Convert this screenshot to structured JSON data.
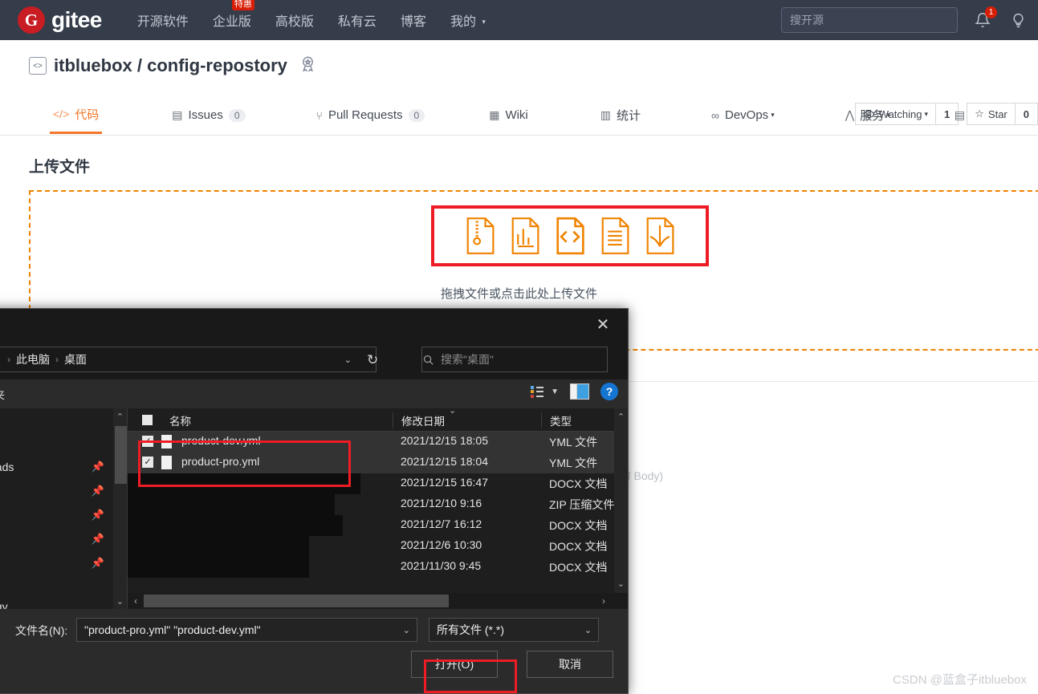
{
  "topnav": {
    "brand_letter": "G",
    "brand": "gitee",
    "items": [
      {
        "label": "开源软件",
        "badge": null,
        "caret": false
      },
      {
        "label": "企业版",
        "badge": "特惠",
        "caret": false
      },
      {
        "label": "高校版",
        "badge": null,
        "caret": false
      },
      {
        "label": "私有云",
        "badge": null,
        "caret": false
      },
      {
        "label": "博客",
        "badge": null,
        "caret": false
      },
      {
        "label": "我的",
        "badge": null,
        "caret": true
      }
    ],
    "search_placeholder": "搜开源",
    "notification_count": "1",
    "bell_icon": "bell-icon",
    "bulb_icon": "lightbulb-icon"
  },
  "repo": {
    "owner": "itbluebox",
    "separator": "/",
    "name": "config-repostory",
    "full_title": "itbluebox / config-repostory",
    "code_icon": "<>",
    "medal_icon": "medal-icon",
    "watch_label": "Watching",
    "watch_count": "1",
    "star_label": "Star",
    "star_count": "0"
  },
  "tabs": [
    {
      "label": "代码",
      "icon": "code-icon",
      "count": null,
      "active": true,
      "caret": false
    },
    {
      "label": "Issues",
      "icon": "issue-icon",
      "count": "0",
      "active": false,
      "caret": false
    },
    {
      "label": "Pull Requests",
      "icon": "pr-icon",
      "count": "0",
      "active": false,
      "caret": false
    },
    {
      "label": "Wiki",
      "icon": "wiki-icon",
      "count": null,
      "active": false,
      "caret": false
    },
    {
      "label": "统计",
      "icon": "chart-icon",
      "count": null,
      "active": false,
      "caret": false
    },
    {
      "label": "DevOps",
      "icon": "infinity-icon",
      "count": null,
      "active": false,
      "caret": true
    },
    {
      "label": "服务",
      "icon": "pulse-icon",
      "count": null,
      "active": false,
      "caret": true
    }
  ],
  "upload": {
    "title": "上传文件",
    "hint": "拖拽文件或点击此处上传文件",
    "filetypes": [
      "zip-file-icon",
      "chart-file-icon",
      "code-file-icon",
      "text-file-icon",
      "pdf-file-icon"
    ],
    "background_placeholder": "it message 的 Body)"
  },
  "dialog": {
    "close_icon": "close-icon",
    "breadcrumb": [
      "此电脑",
      "桌面"
    ],
    "search_placeholder": "搜索\"桌面\"",
    "refresh_icon": "refresh-icon",
    "toolbar_label": "件夹",
    "view_icon": "view-list-icon",
    "pane_icon": "preview-pane-icon",
    "help_icon": "help-icon",
    "sidebar_items": [
      "oads",
      "",
      "",
      "",
      "",
      "ogy"
    ],
    "columns": [
      "名称",
      "修改日期",
      "类型"
    ],
    "files": [
      {
        "name": "product-dev.yml",
        "date": "2021/12/15 18:05",
        "type": "YML 文件",
        "checked": true,
        "selected": true,
        "redacted": false
      },
      {
        "name": "product-pro.yml",
        "date": "2021/12/15 18:04",
        "type": "YML 文件",
        "checked": true,
        "selected": true,
        "redacted": false
      },
      {
        "name": "",
        "date": "2021/12/15 16:47",
        "type": "DOCX 文档",
        "checked": false,
        "selected": false,
        "redacted": true
      },
      {
        "name": "",
        "date": "2021/12/10 9:16",
        "type": "ZIP 压缩文件",
        "checked": false,
        "selected": false,
        "redacted": true
      },
      {
        "name": "",
        "date": "2021/12/7 16:12",
        "type": "DOCX 文档",
        "checked": false,
        "selected": false,
        "redacted": true
      },
      {
        "name": "",
        "date": "2021/12/6 10:30",
        "type": "DOCX 文档",
        "checked": false,
        "selected": false,
        "redacted": true
      },
      {
        "name": "",
        "date": "2021/11/30 9:45",
        "type": "DOCX 文档",
        "checked": false,
        "selected": false,
        "redacted": true
      }
    ],
    "filename_label": "文件名(N):",
    "filename_value": "\"product-pro.yml\" \"product-dev.yml\"",
    "filter_value": "所有文件 (*.*)",
    "open_button": "打开(O)",
    "cancel_button": "取消"
  },
  "watermark": "CSDN @蓝盒子itbluebox",
  "colors": {
    "nav_bg": "#353c4a",
    "brand_red": "#c71d23",
    "accent_orange": "#f3762a",
    "dash_orange": "#f08300",
    "highlight_red": "#ee1c25",
    "dialog_bg": "#2b2b2b",
    "help_blue": "#1476d1"
  }
}
